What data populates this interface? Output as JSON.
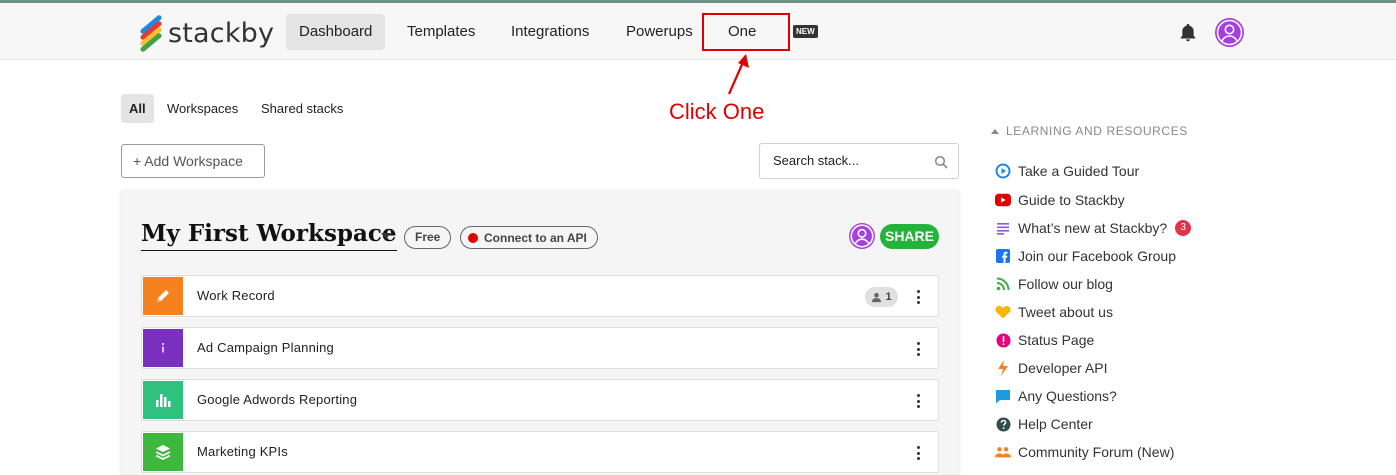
{
  "header": {
    "logo_text": "stackby",
    "nav": [
      {
        "label": "Dashboard",
        "active": true
      },
      {
        "label": "Templates",
        "active": false
      },
      {
        "label": "Integrations",
        "active": false
      },
      {
        "label": "Powerups",
        "active": false
      },
      {
        "label": "One",
        "active": false
      }
    ],
    "new_badge": "NEW"
  },
  "annotation": {
    "text": "Click One",
    "color": "#e00000"
  },
  "filters": {
    "tabs": [
      {
        "label": "All",
        "active": true
      },
      {
        "label": "Workspaces",
        "active": false
      },
      {
        "label": "Shared stacks",
        "active": false
      }
    ]
  },
  "toolbar": {
    "add_workspace_label": "+ Add Workspace",
    "search_placeholder": "Search stack..."
  },
  "workspace": {
    "title": "My First Workspace",
    "plan_badge": "Free",
    "api_badge": "Connect to an API",
    "share_label": "SHARE",
    "stacks": [
      {
        "name": "Work Record",
        "icon": "pencil-icon",
        "color": "#f5821f",
        "members": "1"
      },
      {
        "name": "Ad Campaign Planning",
        "icon": "info-icon",
        "color": "#7b2fbf",
        "members": ""
      },
      {
        "name": "Google Adwords Reporting",
        "icon": "bar-chart-icon",
        "color": "#2ec27e",
        "members": ""
      },
      {
        "name": "Marketing KPIs",
        "icon": "layers-icon",
        "color": "#3db83d",
        "members": ""
      }
    ]
  },
  "resources": {
    "heading": "LEARNING AND RESOURCES",
    "items": [
      {
        "label": "Take a Guided Tour",
        "icon": "play-circle-icon"
      },
      {
        "label": "Guide to Stackby",
        "icon": "youtube-icon"
      },
      {
        "label": "What’s new at Stackby?",
        "icon": "list-icon",
        "badge": "3"
      },
      {
        "label": "Join our Facebook Group",
        "icon": "facebook-icon"
      },
      {
        "label": "Follow our blog",
        "icon": "rss-icon"
      },
      {
        "label": "Tweet about us",
        "icon": "heart-icon"
      },
      {
        "label": "Status Page",
        "icon": "alert-icon"
      },
      {
        "label": "Developer API",
        "icon": "bolt-icon"
      },
      {
        "label": "Any Questions?",
        "icon": "chat-icon"
      },
      {
        "label": "Help Center",
        "icon": "help-icon"
      },
      {
        "label": "Community Forum (New)",
        "icon": "community-icon"
      }
    ]
  }
}
